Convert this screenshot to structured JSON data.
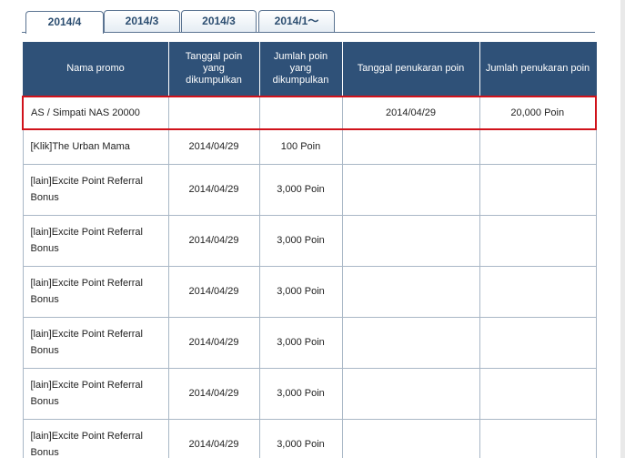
{
  "tabs": [
    {
      "label": "2014/4"
    },
    {
      "label": "2014/3"
    },
    {
      "label": "2014/3"
    },
    {
      "label": "2014/1〜"
    }
  ],
  "table": {
    "headers": {
      "name": "Nama promo",
      "collect_date": "Tanggal poin yang dikumpulkan",
      "collect_amount": "Jumlah poin yang dikumpulkan",
      "redeem_date": "Tanggal penukaran poin",
      "redeem_amount": "Jumlah penukaran poin"
    },
    "rows": [
      {
        "name": "AS / Simpati NAS 20000",
        "collect_date": "",
        "collect_amount": "",
        "redeem_date": "2014/04/29",
        "redeem_amount": "20,000 Poin"
      },
      {
        "name": "[Klik]The Urban Mama",
        "collect_date": "2014/04/29",
        "collect_amount": "100 Poin",
        "redeem_date": "",
        "redeem_amount": ""
      },
      {
        "name": "[lain]Excite Point Referral Bonus",
        "collect_date": "2014/04/29",
        "collect_amount": "3,000 Poin",
        "redeem_date": "",
        "redeem_amount": ""
      },
      {
        "name": "[lain]Excite Point Referral Bonus",
        "collect_date": "2014/04/29",
        "collect_amount": "3,000 Poin",
        "redeem_date": "",
        "redeem_amount": ""
      },
      {
        "name": "[lain]Excite Point Referral Bonus",
        "collect_date": "2014/04/29",
        "collect_amount": "3,000 Poin",
        "redeem_date": "",
        "redeem_amount": ""
      },
      {
        "name": "[lain]Excite Point Referral Bonus",
        "collect_date": "2014/04/29",
        "collect_amount": "3,000 Poin",
        "redeem_date": "",
        "redeem_amount": ""
      },
      {
        "name": "[lain]Excite Point Referral Bonus",
        "collect_date": "2014/04/29",
        "collect_amount": "3,000 Poin",
        "redeem_date": "",
        "redeem_amount": ""
      },
      {
        "name": "[lain]Excite Point Referral Bonus",
        "collect_date": "2014/04/29",
        "collect_amount": "3,000 Poin",
        "redeem_date": "",
        "redeem_amount": ""
      }
    ]
  }
}
